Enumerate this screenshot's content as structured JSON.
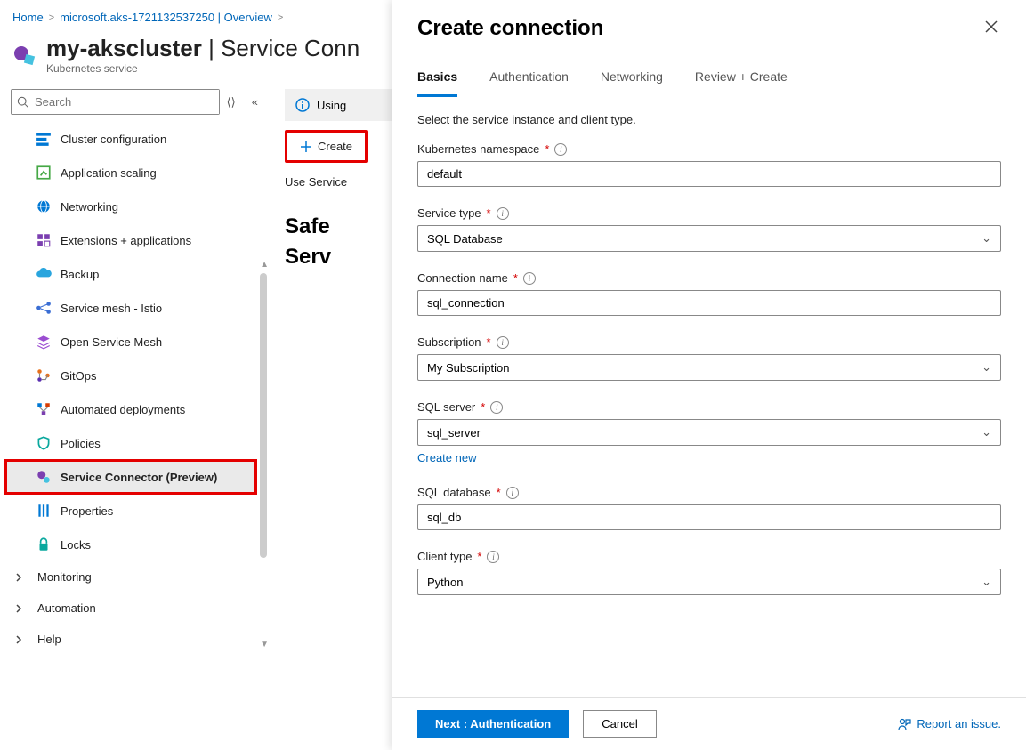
{
  "breadcrumb": {
    "home": "Home",
    "resource": "microsoft.aks-1721132537250 | Overview",
    "current": ""
  },
  "header": {
    "title": "my-akscluster",
    "title_suffix": " | Service Conn",
    "subtitle": "Kubernetes service"
  },
  "search": {
    "placeholder": "Search"
  },
  "sidebar": {
    "items": [
      {
        "label": "Cluster configuration"
      },
      {
        "label": "Application scaling"
      },
      {
        "label": "Networking"
      },
      {
        "label": "Extensions + applications"
      },
      {
        "label": "Backup"
      },
      {
        "label": "Service mesh - Istio"
      },
      {
        "label": "Open Service Mesh"
      },
      {
        "label": "GitOps"
      },
      {
        "label": "Automated deployments"
      },
      {
        "label": "Policies"
      },
      {
        "label": "Service Connector (Preview)"
      },
      {
        "label": "Properties"
      },
      {
        "label": "Locks"
      }
    ],
    "groups": [
      {
        "label": "Monitoring"
      },
      {
        "label": "Automation"
      },
      {
        "label": "Help"
      }
    ]
  },
  "main": {
    "info_bar": "Using",
    "create_button": "Create",
    "subtext": "Use Service ",
    "heading_line1": "Safe",
    "heading_line2": "Serv"
  },
  "panel": {
    "title": "Create connection",
    "tabs": [
      {
        "label": "Basics"
      },
      {
        "label": "Authentication"
      },
      {
        "label": "Networking"
      },
      {
        "label": "Review + Create"
      }
    ],
    "desc": "Select the service instance and client type.",
    "fields": {
      "namespace": {
        "label": "Kubernetes namespace",
        "value": "default"
      },
      "service_type": {
        "label": "Service type",
        "value": "SQL Database"
      },
      "connection_name": {
        "label": "Connection name",
        "value": "sql_connection"
      },
      "subscription": {
        "label": "Subscription",
        "value": "My Subscription"
      },
      "sql_server": {
        "label": "SQL server",
        "value": "sql_server",
        "create_new": "Create new"
      },
      "sql_database": {
        "label": "SQL database",
        "value": "sql_db"
      },
      "client_type": {
        "label": "Client type",
        "value": "Python"
      }
    },
    "footer": {
      "next": "Next : Authentication",
      "cancel": "Cancel",
      "report": "Report an issue."
    }
  }
}
